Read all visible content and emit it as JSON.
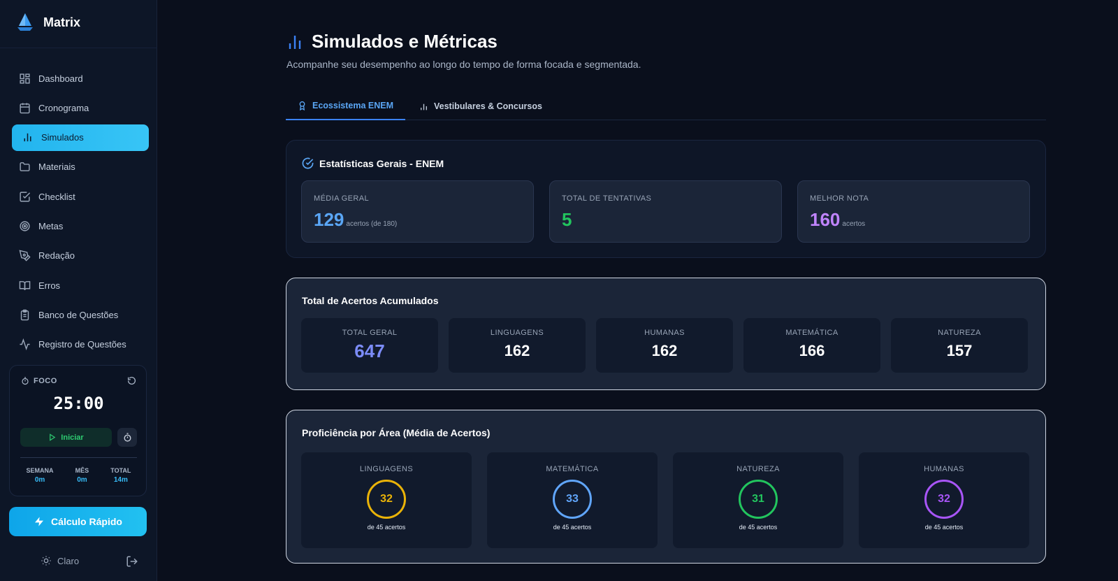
{
  "app": {
    "name": "Matrix"
  },
  "sidebar": {
    "items": [
      {
        "label": "Dashboard",
        "icon": "dashboard-icon"
      },
      {
        "label": "Cronograma",
        "icon": "calendar-icon"
      },
      {
        "label": "Simulados",
        "icon": "bar-chart-icon",
        "active": true
      },
      {
        "label": "Materiais",
        "icon": "folder-icon"
      },
      {
        "label": "Checklist",
        "icon": "checkbox-icon"
      },
      {
        "label": "Metas",
        "icon": "target-icon"
      },
      {
        "label": "Redação",
        "icon": "pen-icon"
      },
      {
        "label": "Erros",
        "icon": "book-icon"
      },
      {
        "label": "Banco de Questões",
        "icon": "clipboard-icon"
      },
      {
        "label": "Registro de Questões",
        "icon": "activity-icon"
      }
    ],
    "focus": {
      "label": "FOCO",
      "timer": "25:00",
      "start_label": "Iniciar",
      "stats": [
        {
          "label": "SEMANA",
          "value": "0m"
        },
        {
          "label": "MÊS",
          "value": "0m"
        },
        {
          "label": "TOTAL",
          "value": "14m"
        }
      ]
    },
    "quick_button": "Cálculo Rápido",
    "theme_label": "Claro"
  },
  "header": {
    "title": "Simulados e Métricas",
    "subtitle": "Acompanhe seu desempenho ao longo do tempo de forma focada e segmentada."
  },
  "tabs": [
    {
      "label": "Ecossistema ENEM",
      "active": true
    },
    {
      "label": "Vestibulares & Concursos",
      "active": false
    }
  ],
  "stats": {
    "title": "Estatísticas Gerais - ENEM",
    "boxes": [
      {
        "label": "MÉDIA GERAL",
        "value": "129",
        "unit": "acertos (de 180)",
        "color": "#5aa6f5"
      },
      {
        "label": "TOTAL DE TENTATIVAS",
        "value": "5",
        "unit": "",
        "color": "#22c55e"
      },
      {
        "label": "MELHOR NOTA",
        "value": "160",
        "unit": "acertos",
        "color": "#c084fc"
      }
    ]
  },
  "accumulated": {
    "title": "Total de Acertos Acumulados",
    "boxes": [
      {
        "label": "TOTAL GERAL",
        "value": "647"
      },
      {
        "label": "LINGUAGENS",
        "value": "162"
      },
      {
        "label": "HUMANAS",
        "value": "162"
      },
      {
        "label": "MATEMÁTICA",
        "value": "166"
      },
      {
        "label": "NATUREZA",
        "value": "157"
      }
    ]
  },
  "proficiency": {
    "title": "Proficiência por Área (Média de Acertos)",
    "areas": [
      {
        "label": "LINGUAGENS",
        "value": "32",
        "sub": "de 45 acertos",
        "color": "#eab308"
      },
      {
        "label": "MATEMÁTICA",
        "value": "33",
        "sub": "de 45 acertos",
        "color": "#60a5fa"
      },
      {
        "label": "NATUREZA",
        "value": "31",
        "sub": "de 45 acertos",
        "color": "#22c55e"
      },
      {
        "label": "HUMANAS",
        "value": "32",
        "sub": "de 45 acertos",
        "color": "#a855f7"
      }
    ]
  }
}
